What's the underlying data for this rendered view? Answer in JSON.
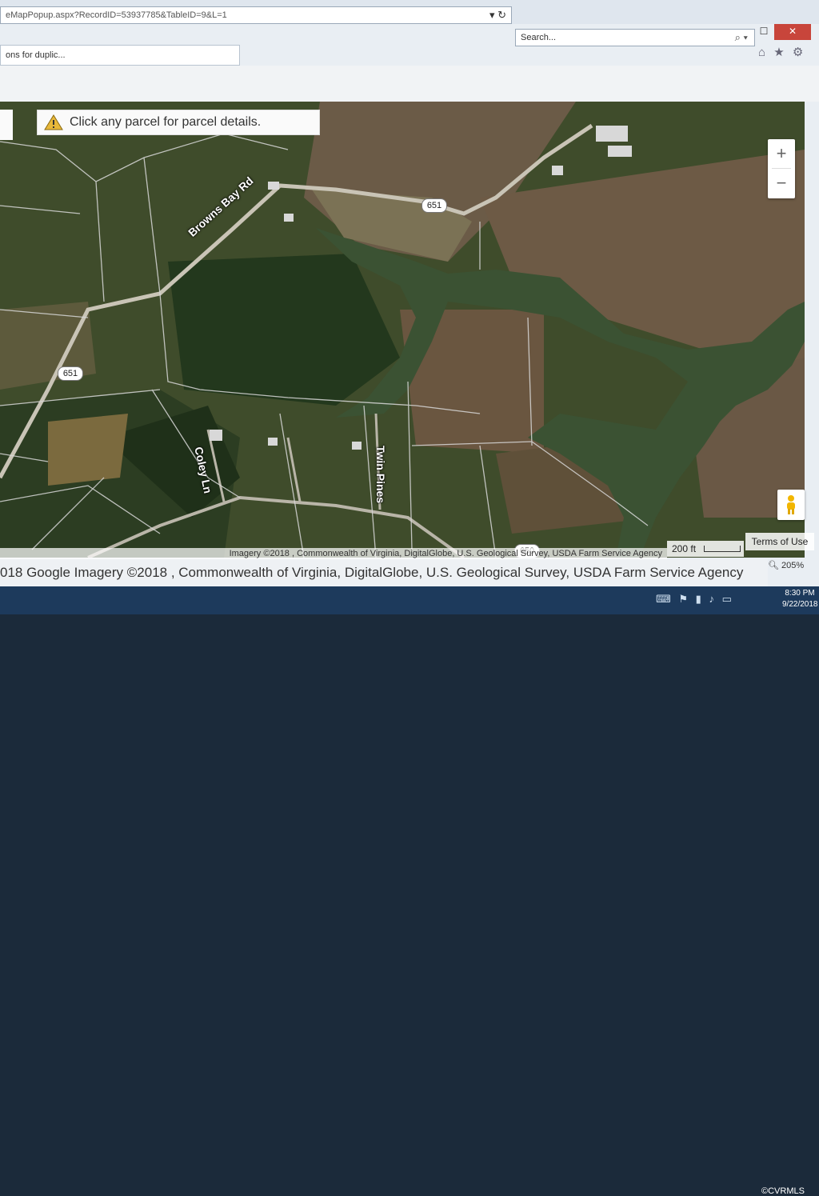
{
  "browser": {
    "url": "eMapPopup.aspx?RecordID=53937785&TableID=9&L=1",
    "search_placeholder": "Search...",
    "tab_title": "ons for duplic...",
    "win_min": "─",
    "win_max": "☐",
    "win_close": "✕",
    "refresh": "↻",
    "dropdown": "▾"
  },
  "map": {
    "banner_text": "Click any parcel for parcel details.",
    "roads": {
      "browns_bay": "Browns Bay Rd",
      "coley": "Coley Ln",
      "twin_pines": "Twin Pines"
    },
    "shields": {
      "top": "651",
      "left": "651",
      "bottom": "650"
    },
    "zoom_in": "+",
    "zoom_out": "−",
    "scale": "200 ft",
    "terms": "Terms of Use",
    "attribution": "Imagery ©2018 , Commonwealth of Virginia, DigitalGlobe, U.S. Geological Survey, USDA Farm Service Agency"
  },
  "footer": {
    "copyright": "018 Google Imagery ©2018 , Commonwealth of Virginia, DigitalGlobe, U.S. Geological Survey, USDA Farm Service Agency",
    "zoom_level": "205%"
  },
  "taskbar": {
    "time": "8:30 PM",
    "date": "9/22/2018",
    "watermark": "©CVRMLS"
  }
}
